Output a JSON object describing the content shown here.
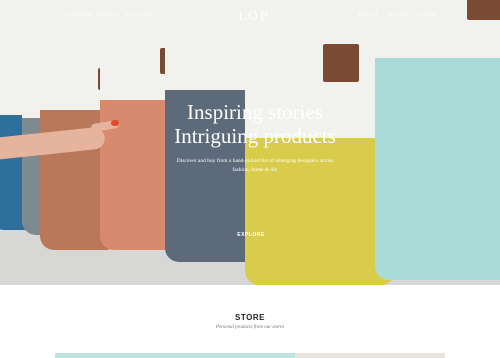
{
  "nav": {
    "left_items": [
      "STORIES",
      "EVENTS",
      "CULTURE"
    ],
    "logo": "LOP",
    "right_items": [
      "ABOUT",
      "STORE",
      "LOGIN"
    ]
  },
  "hero": {
    "headline_line1": "Inspiring stories",
    "headline_line2": "Intriguing products",
    "subtitle": "Discover and buy from a hand-picked list of emerging designers across fashion, home & diy",
    "cta_label": "EXPLORE"
  },
  "store": {
    "title": "STORE",
    "subtitle": "Personal products from our stores"
  },
  "colors": {
    "accent_blue": "#2f6f9c",
    "bag_slate": "#5c6a7a",
    "bag_salmon": "#d88a6e",
    "bag_mustard": "#d9cc4a",
    "bag_mint": "#a9dcd8",
    "leather_patch": "#7a4a33"
  }
}
